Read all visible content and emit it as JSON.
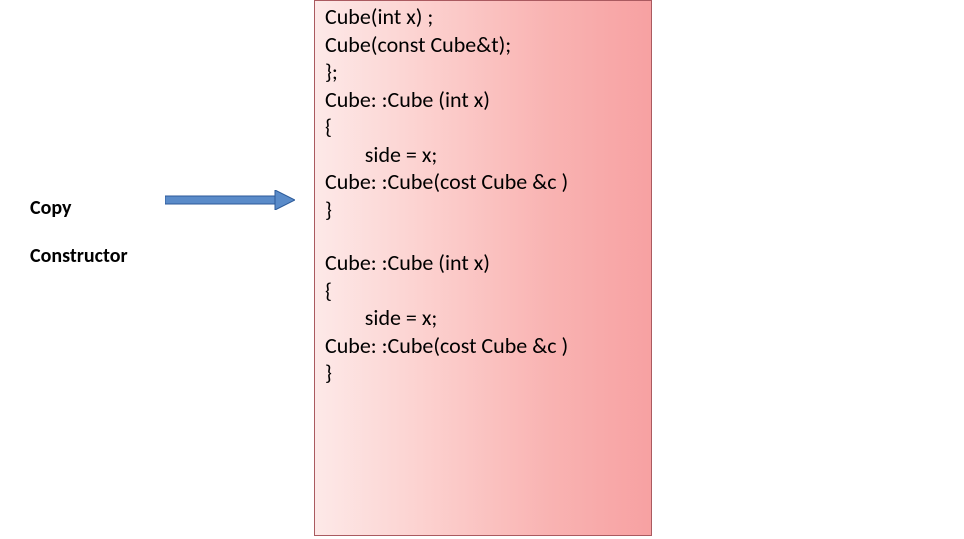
{
  "label": {
    "line1": "Copy",
    "line2": "Constructor"
  },
  "arrow": {
    "name": "arrow-right"
  },
  "code": {
    "block1": {
      "l1": "Cube(int x) ;",
      "l2": "Cube(const Cube&t);",
      "l3": "};",
      "l4": "Cube: :Cube (int x)",
      "l5": "{",
      "l6": "        side = x;",
      "l7": "Cube: :Cube(cost Cube &c )",
      "l8": "}"
    },
    "block2": {
      "l1": "Cube: :Cube (int x)",
      "l2": "{",
      "l3": "        side = x;",
      "l4": "Cube: :Cube(cost Cube &c )",
      "l5": "}"
    }
  }
}
